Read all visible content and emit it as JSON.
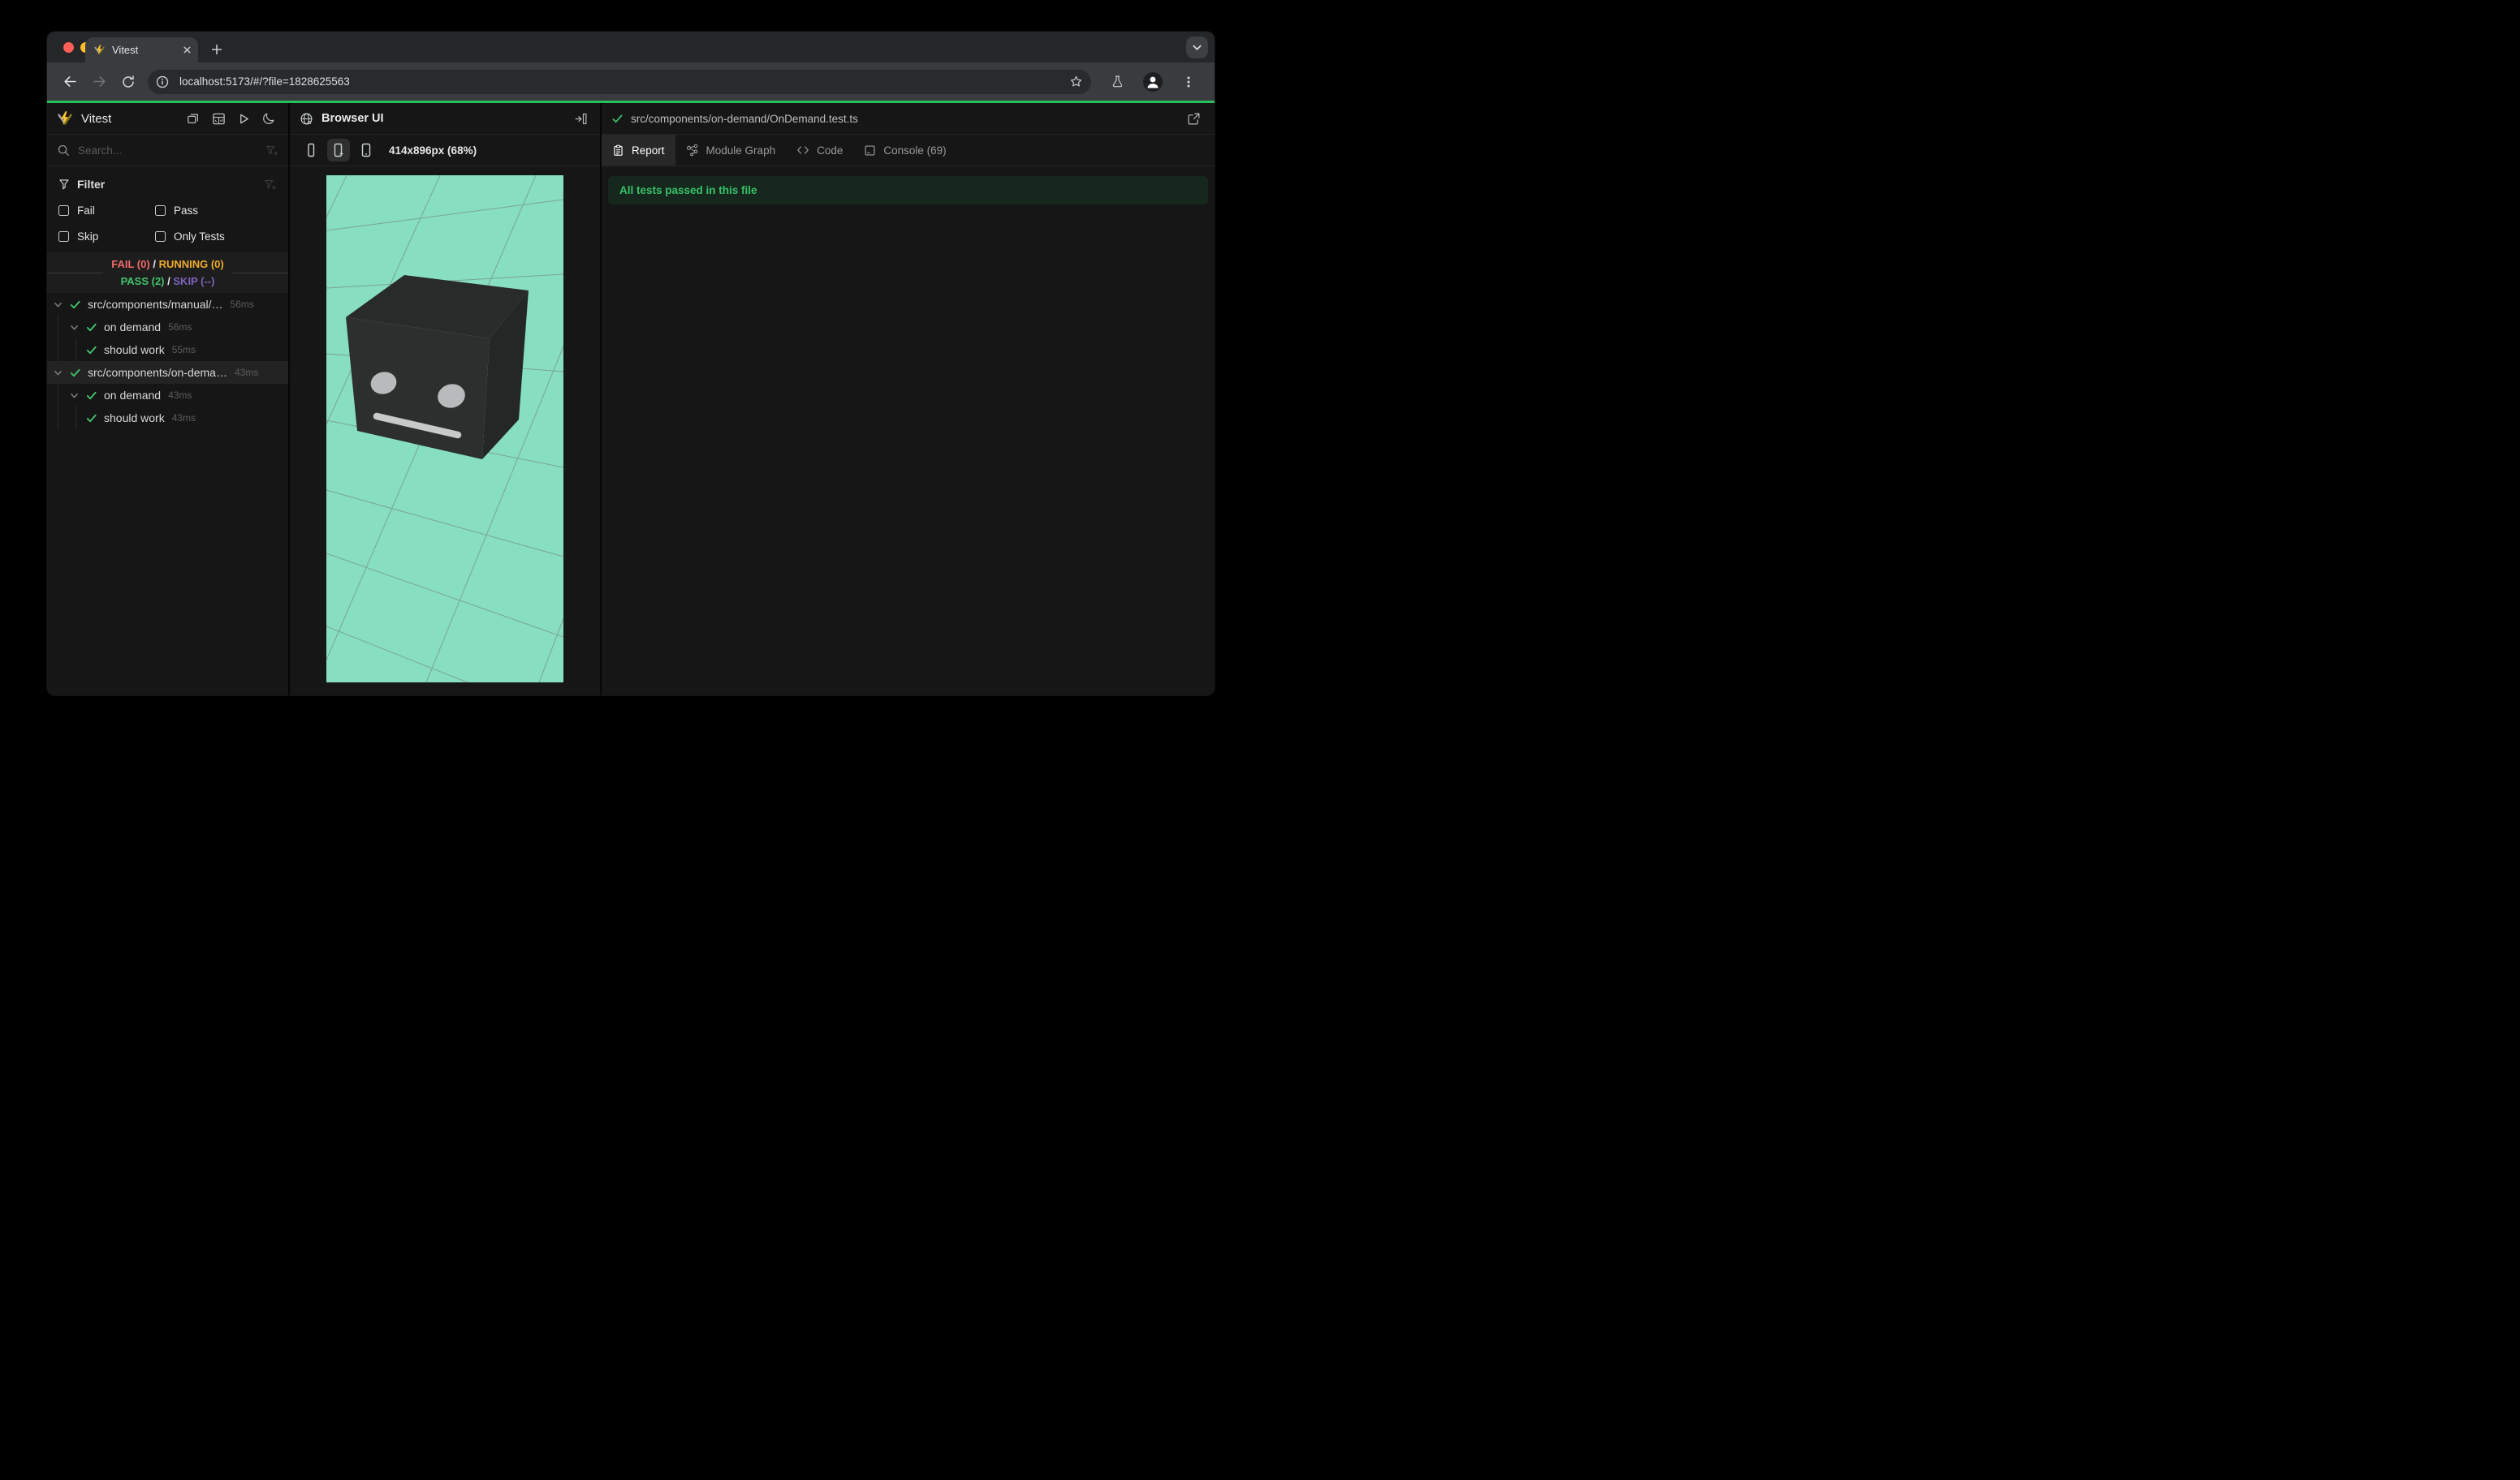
{
  "window": {
    "tab_title": "Vitest",
    "url": "localhost:5173/#/?file=1828625563"
  },
  "colors": {
    "accent_green": "#27c05e",
    "pass_green": "#42c36c",
    "fail_red": "#f16a6a",
    "running_amber": "#efac2c",
    "skip_purple": "#7d63bf",
    "viewport_mint": "#87dec0",
    "banner_bg": "#16281d",
    "banner_text": "#38c169",
    "traffic_red": "#ff5f57",
    "traffic_yellow": "#febc2e",
    "traffic_green": "#28c840"
  },
  "sidebar": {
    "title": "Vitest",
    "search_placeholder": "Search...",
    "filter": {
      "title": "Filter",
      "fail": "Fail",
      "pass": "Pass",
      "skip": "Skip",
      "only_tests": "Only Tests"
    },
    "stats": {
      "fail": "FAIL (0)",
      "sep": "/",
      "running": "RUNNING (0)",
      "pass": "PASS (2)",
      "skip": "SKIP (--)"
    },
    "tree": [
      {
        "label": "src/components/manual/…",
        "duration": "56ms"
      },
      {
        "label": "on demand",
        "duration": "56ms"
      },
      {
        "label": "should work",
        "duration": "55ms"
      },
      {
        "label": "src/components/on-dema…",
        "duration": "43ms"
      },
      {
        "label": "on demand",
        "duration": "43ms"
      },
      {
        "label": "should work",
        "duration": "43ms"
      }
    ]
  },
  "browser_panel": {
    "title": "Browser UI",
    "size_label": "414x896px (68%)"
  },
  "report_panel": {
    "file": "src/components/on-demand/OnDemand.test.ts",
    "tabs": [
      {
        "label": "Report"
      },
      {
        "label": "Module Graph"
      },
      {
        "label": "Code"
      },
      {
        "label": "Console (69)"
      }
    ],
    "banner": "All tests passed in this file"
  }
}
